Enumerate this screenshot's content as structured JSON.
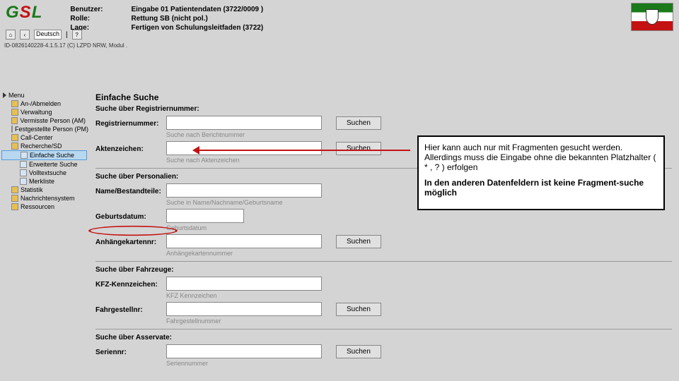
{
  "header": {
    "logo": "GSL",
    "labels": {
      "benutzer": "Benutzer:",
      "rolle": "Rolle:",
      "lage": "Lage:"
    },
    "values": {
      "benutzer": "Eingabe 01 Patientendaten (3722/0009 )",
      "rolle": "Rettung SB (nicht pol.)",
      "lage": "Fertigen von Schulungsleitfaden (3722)"
    }
  },
  "controls": {
    "lang": "Deutsch",
    "sep": "|"
  },
  "status": "ID-0826140228-4.1.5.17 (C) LZPD NRW, Modul .",
  "sidebar": {
    "title": "Menu",
    "items": [
      {
        "label": "An-/Abmelden",
        "level": 2
      },
      {
        "label": "Verwaltung",
        "level": 2
      },
      {
        "label": "Vermisste Person (AM)",
        "level": 2
      },
      {
        "label": "Festgestellte Person (PM)",
        "level": 2
      },
      {
        "label": "Call-Center",
        "level": 2
      },
      {
        "label": "Recherche/SD",
        "level": 2
      },
      {
        "label": "Einfache Suche",
        "level": 3,
        "selected": true
      },
      {
        "label": "Erweiterte Suche",
        "level": 3
      },
      {
        "label": "Volltextsuche",
        "level": 3
      },
      {
        "label": "Merkliste",
        "level": 3
      },
      {
        "label": "Statistik",
        "level": 2
      },
      {
        "label": "Nachrichtensystem",
        "level": 2
      },
      {
        "label": "Ressourcen",
        "level": 2
      }
    ]
  },
  "form": {
    "title": "Einfache Suche",
    "sec1": {
      "title": "Suche über Registriernummer:",
      "f1": {
        "label": "Registriernummer:",
        "hint": "Suche nach Berichtnummer"
      },
      "f2": {
        "label": "Aktenzeichen:",
        "hint": "Suche nach Aktenzeichen"
      }
    },
    "sec2": {
      "title": "Suche über Personalien:",
      "f1": {
        "label": "Name/Bestandteile:",
        "hint": "Suche in Name/Nachname/Geburtsname"
      },
      "f2": {
        "label": "Geburtsdatum:",
        "hint": "Geburtsdatum"
      },
      "f3": {
        "label": "Anhängekartennr:",
        "hint": "Anhängekartennummer"
      }
    },
    "sec3": {
      "title": "Suche über Fahrzeuge:",
      "f1": {
        "label": "KFZ-Kennzeichen:",
        "hint": "KFZ Kennzeichen"
      },
      "f2": {
        "label": "Fahrgestellnr:",
        "hint": "Fahrgestellnummer"
      }
    },
    "sec4": {
      "title": "Suche über Asservate:",
      "f1": {
        "label": "Seriennr:",
        "hint": "Seriennummer"
      }
    },
    "btn": "Suchen"
  },
  "callout": {
    "p1": "Hier kann auch nur mit Fragmenten gesucht werden.",
    "p2": "Allerdings muss die Eingabe ohne die bekannten Platzhalter ( * , ? ) erfolgen",
    "p3": "In den anderen Datenfeldern ist keine Fragment-suche möglich"
  }
}
